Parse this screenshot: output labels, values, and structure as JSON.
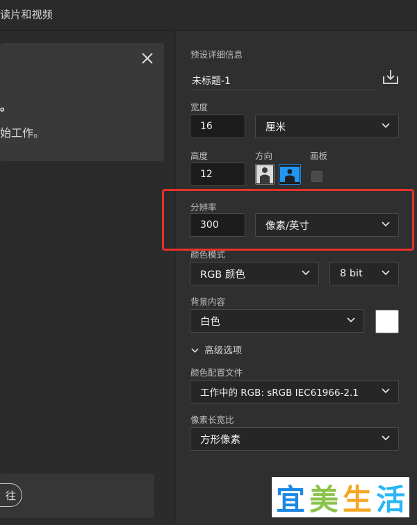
{
  "app": {
    "title": "读片和视频"
  },
  "left_panel": {
    "close_icon": "close-icon",
    "heading": "。",
    "text": "始工作。",
    "bottom_button_label": "往"
  },
  "preset": {
    "section_label": "预设详细信息",
    "name": "未标题-1",
    "save_icon": "save-preset-icon"
  },
  "width": {
    "label": "宽度",
    "value": "16",
    "unit": "厘米"
  },
  "height": {
    "label": "高度",
    "value": "12"
  },
  "orientation": {
    "label": "方向",
    "options": [
      "portrait",
      "landscape"
    ],
    "selected": "landscape"
  },
  "artboard": {
    "label": "画板",
    "checked": false
  },
  "resolution": {
    "label": "分辨率",
    "value": "300",
    "unit": "像素/英寸"
  },
  "color_mode": {
    "label": "颜色模式",
    "mode": "RGB 颜色",
    "depth": "8 bit"
  },
  "background": {
    "label": "背景内容",
    "value": "白色",
    "swatch_color": "#ffffff"
  },
  "advanced": {
    "label": "高级选项",
    "expanded": true
  },
  "color_profile": {
    "label": "颜色配置文件",
    "value": "工作中的 RGB: sRGB IEC61966-2.1"
  },
  "pixel_aspect": {
    "label": "像素长宽比",
    "value": "方形像素"
  },
  "watermark": {
    "chars": [
      "宜",
      "美",
      "生",
      "活"
    ],
    "colors": [
      "#1e88e5",
      "#8bc34a",
      "#f5a623",
      "#29b6f6"
    ]
  },
  "highlight_color": "#e8312a"
}
